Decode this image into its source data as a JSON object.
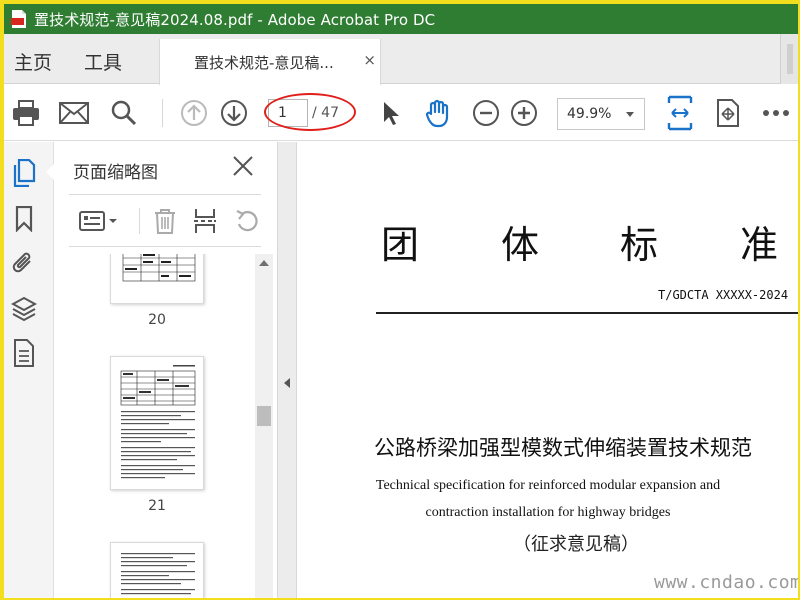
{
  "window": {
    "title": "置技术规范-意见稿2024.08.pdf - Adobe Acrobat Pro DC"
  },
  "tabs": {
    "home": "主页",
    "tools": "工具",
    "document_tab": "置技术规范-意见稿...",
    "document_tab_close": "×"
  },
  "toolbar": {
    "current_page": "1",
    "total_pages": "/ 47",
    "zoom": "49.9%",
    "icons": [
      "print-icon",
      "email-icon",
      "search-icon",
      "page-up-icon",
      "page-down-icon",
      "select-cursor-icon",
      "hand-tool-icon",
      "zoom-out-icon",
      "zoom-in-icon",
      "fit-page-icon",
      "rotate-view-icon",
      "more-icon"
    ],
    "annotation_color": "#e0201a"
  },
  "left_rail": {
    "icons": [
      "page-thumbnails-icon",
      "bookmark-icon",
      "attachment-icon",
      "layers-icon",
      "document-properties-icon"
    ],
    "active_color": "#1a73c9"
  },
  "thumbnails_panel": {
    "title": "页面缩略图",
    "close": "×",
    "tool_icons": [
      "thumbnail-options-icon",
      "delete-page-icon",
      "insert-page-icon",
      "undo-icon"
    ],
    "pages": [
      {
        "label": "20"
      },
      {
        "label": "21"
      },
      {
        "label": ""
      }
    ]
  },
  "document": {
    "heading_chars": [
      "团",
      "体",
      "标",
      "准"
    ],
    "standard_code": "T/GDCTA XXXXX-2024",
    "title_cn": "公路桥梁加强型模数式伸缩装置技术规范",
    "title_en_line1": "Technical specification for reinforced modular expansion and",
    "title_en_line2": "contraction installation for highway bridges",
    "draft_note": "（征求意见稿）"
  },
  "watermark": "www.cndao.com",
  "colors": {
    "titlebar": "#2e7d32",
    "outer_border": "#f2de1c",
    "accent_blue": "#1a73c9"
  }
}
